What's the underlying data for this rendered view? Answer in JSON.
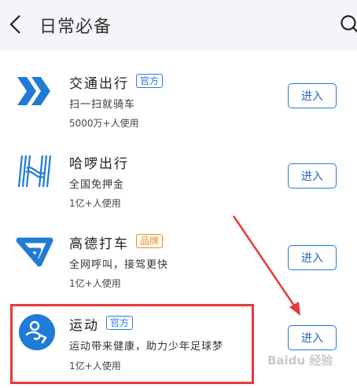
{
  "header": {
    "title": "日常必备"
  },
  "apps": [
    {
      "name": "交通出行",
      "tag": "官方",
      "tag_color": "#2c7be5",
      "description": "扫一扫就骑车",
      "users": "5000万+人使用",
      "button": "进入",
      "icon": "double-chevron-icon"
    },
    {
      "name": "哈啰出行",
      "tag": "",
      "description": "全国免押金",
      "users": "1亿+人使用",
      "button": "进入",
      "icon": "hello-h-icon"
    },
    {
      "name": "高德打车",
      "tag": "品牌",
      "tag_color": "#f08a1d",
      "description": "全网呼叫，接驾更快",
      "users": "1亿+人使用",
      "button": "进入",
      "icon": "amap-taxi-icon"
    },
    {
      "name": "运动",
      "tag": "官方",
      "tag_color": "#2c7be5",
      "description": "运动带来健康，助力少年足球梦",
      "users": "1亿+人使用",
      "button": "进入",
      "icon": "running-person-icon"
    }
  ],
  "annotation": {
    "highlight_color": "#e8393a"
  },
  "watermark": "Baidu 经验"
}
